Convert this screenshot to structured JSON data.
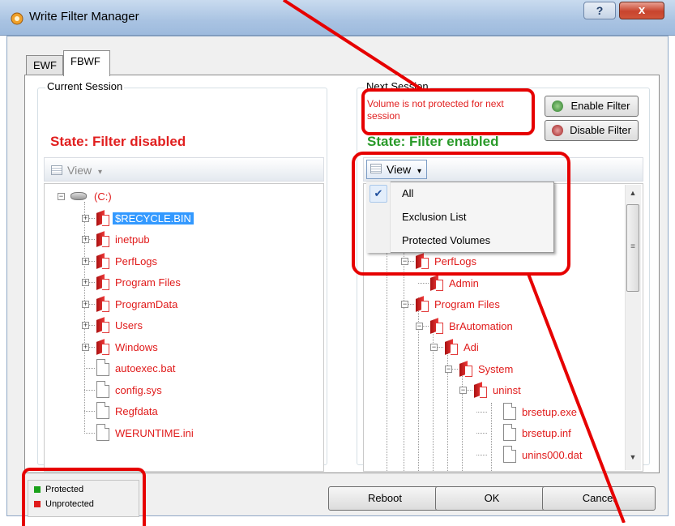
{
  "window": {
    "title": "Write Filter Manager",
    "help_label": "?",
    "close_label": "x"
  },
  "tabs": [
    {
      "label": "EWF",
      "selected": false
    },
    {
      "label": "FBWF",
      "selected": true
    }
  ],
  "current_session": {
    "label": "Current Session",
    "state": "State: Filter disabled",
    "view_label": "View",
    "tree": [
      {
        "label": "(C:)",
        "kind": "drive"
      },
      {
        "label": "$RECYCLE.BIN",
        "kind": "folder",
        "selected": true
      },
      {
        "label": "inetpub",
        "kind": "folder"
      },
      {
        "label": "PerfLogs",
        "kind": "folder"
      },
      {
        "label": "Program Files",
        "kind": "folder"
      },
      {
        "label": "ProgramData",
        "kind": "folder"
      },
      {
        "label": "Users",
        "kind": "folder"
      },
      {
        "label": "Windows",
        "kind": "folder"
      },
      {
        "label": "autoexec.bat",
        "kind": "file"
      },
      {
        "label": "config.sys",
        "kind": "file"
      },
      {
        "label": "Regfdata",
        "kind": "file"
      },
      {
        "label": "WERUNTIME.ini",
        "kind": "file"
      }
    ]
  },
  "next_session": {
    "label": "Next Session",
    "message": "Volume is not protected for next session",
    "state": "State: Filter enabled",
    "enable_label": "Enable Filter",
    "disable_label": "Disable Filter",
    "view_label": "View",
    "view_menu": [
      {
        "label": "All",
        "checked": true
      },
      {
        "label": "Exclusion List",
        "checked": false
      },
      {
        "label": "Protected Volumes",
        "checked": false
      }
    ],
    "tree": [
      {
        "label": "PerfLogs",
        "kind": "folder"
      },
      {
        "label": "Admin",
        "kind": "folder"
      },
      {
        "label": "Program Files",
        "kind": "folder"
      },
      {
        "label": "BrAutomation",
        "kind": "folder"
      },
      {
        "label": "Adi",
        "kind": "folder"
      },
      {
        "label": "System",
        "kind": "folder"
      },
      {
        "label": "uninst",
        "kind": "folder"
      },
      {
        "label": "brsetup.exe",
        "kind": "file"
      },
      {
        "label": "brsetup.inf",
        "kind": "file"
      },
      {
        "label": "unins000.dat",
        "kind": "file"
      }
    ]
  },
  "legend": {
    "protected": "Protected",
    "unprotected": "Unprotected",
    "protected_color": "#1aa11a",
    "unprotected_color": "#e01b1b"
  },
  "buttons": {
    "reboot": "Reboot",
    "ok": "OK",
    "cancel": "Cancel"
  },
  "colors": {
    "annotation_red": "#e60000",
    "state_disabled": "#e11f1f",
    "state_enabled": "#2a9a2a",
    "selection": "#3399ff"
  }
}
